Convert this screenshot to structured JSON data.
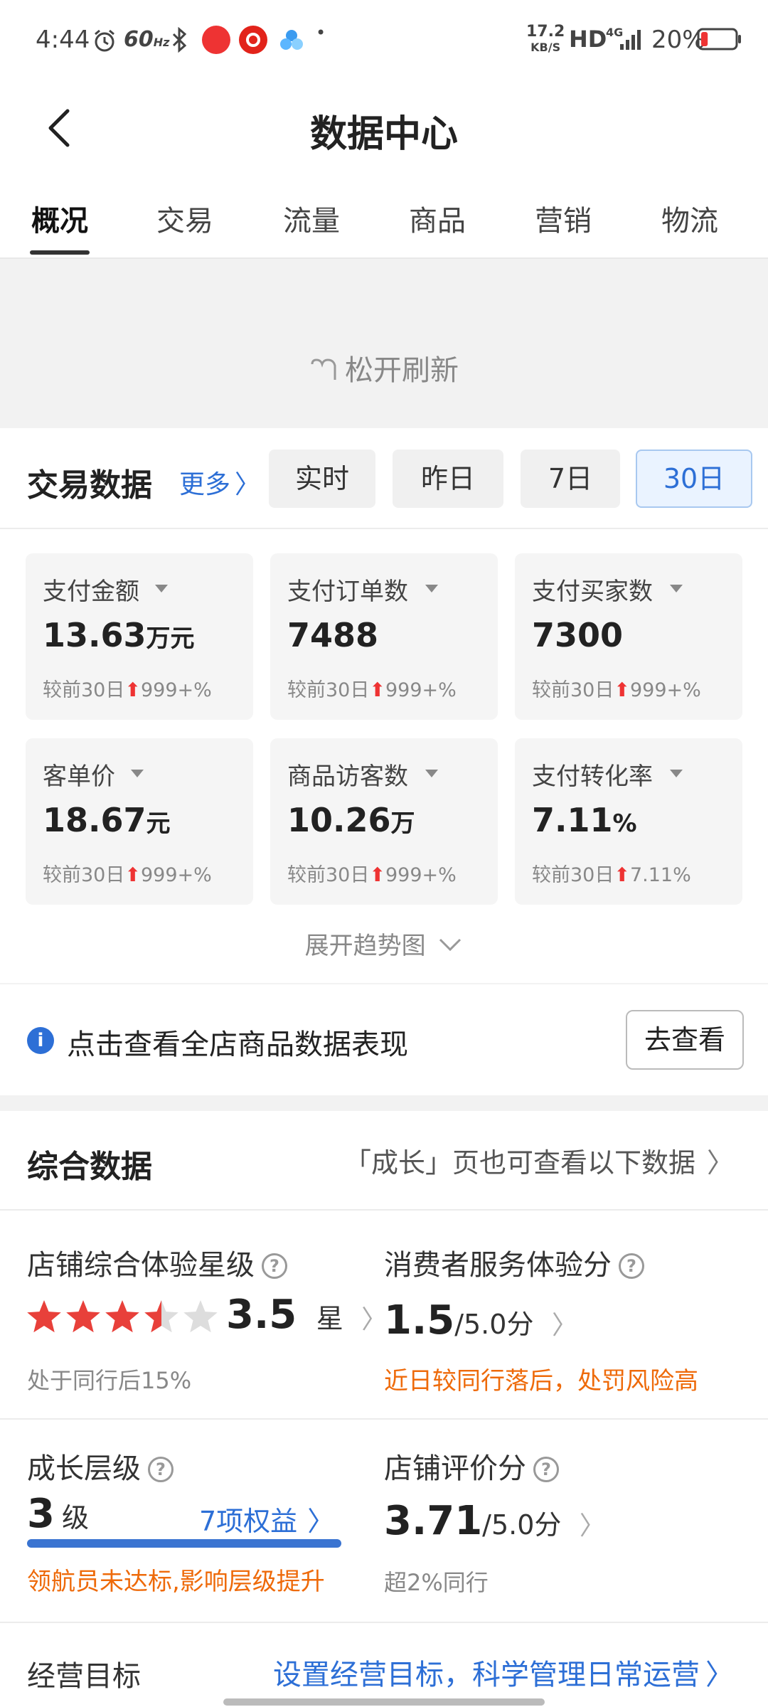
{
  "status_bar": {
    "time": "4:44",
    "refresh_rate": "60",
    "refresh_rate_unit": "Hz",
    "net_speed_value": "17.2",
    "net_speed_unit": "KB/S",
    "hd_label": "HD",
    "network_label": "4G",
    "battery_percent": "20%",
    "battery_level": 0.2,
    "dot": "•"
  },
  "header": {
    "title": "数据中心"
  },
  "tabs": [
    {
      "label": "概况",
      "active": true
    },
    {
      "label": "交易"
    },
    {
      "label": "流量"
    },
    {
      "label": "商品"
    },
    {
      "label": "营销"
    },
    {
      "label": "物流"
    }
  ],
  "refresh": {
    "text": "松开刷新"
  },
  "trade": {
    "title": "交易数据",
    "more_label": "更多",
    "periods": [
      {
        "label": "实时"
      },
      {
        "label": "昨日"
      },
      {
        "label": "7日"
      },
      {
        "label": "30日",
        "active": true
      }
    ],
    "metrics": [
      {
        "label": "支付金额",
        "value": "13.63",
        "unit": "万元",
        "compare_prefix": "较前30日",
        "compare_value": "999+%"
      },
      {
        "label": "支付订单数",
        "value": "7488",
        "unit": "",
        "compare_prefix": "较前30日",
        "compare_value": "999+%"
      },
      {
        "label": "支付买家数",
        "value": "7300",
        "unit": "",
        "compare_prefix": "较前30日",
        "compare_value": "999+%"
      },
      {
        "label": "客单价",
        "value": "18.67",
        "unit": "元",
        "compare_prefix": "较前30日",
        "compare_value": "999+%"
      },
      {
        "label": "商品访客数",
        "value": "10.26",
        "unit": "万",
        "compare_prefix": "较前30日",
        "compare_value": "999+%"
      },
      {
        "label": "支付转化率",
        "value": "7.11",
        "unit": "%",
        "compare_prefix": "较前30日",
        "compare_value": "7.11%"
      }
    ],
    "expand_label": "展开趋势图"
  },
  "tip": {
    "icon": "i",
    "text": "点击查看全店商品数据表现",
    "button": "去查看"
  },
  "comprehensive": {
    "title": "综合数据",
    "hint": "「成长」页也可查看以下数据",
    "store_rating": {
      "title": "店铺综合体验星级",
      "stars_value": 3.5,
      "stars_max": 5,
      "value": "3.5",
      "unit": "星",
      "sub": "处于同行后15%"
    },
    "service_score": {
      "title": "消费者服务体验分",
      "value": "1.5",
      "unit": "/5.0分",
      "warning": "近日较同行落后，处罚风险高"
    },
    "growth_level": {
      "title": "成长层级",
      "value": "3",
      "unit": "级",
      "benefit": "7项权益",
      "progress": 1.0,
      "warning": "领航员未达标,影响层级提升"
    },
    "review_score": {
      "title": "店铺评价分",
      "value": "3.71",
      "unit": "/5.0分",
      "sub": "超2%同行"
    },
    "business_goal": {
      "title": "经营目标",
      "link": "设置经营目标，科学管理日常运营"
    }
  },
  "colors": {
    "accent_blue": "#2d6fd6",
    "up_red": "#e33333",
    "warning_orange": "#ee6a0a",
    "star_red": "#e8403a"
  }
}
